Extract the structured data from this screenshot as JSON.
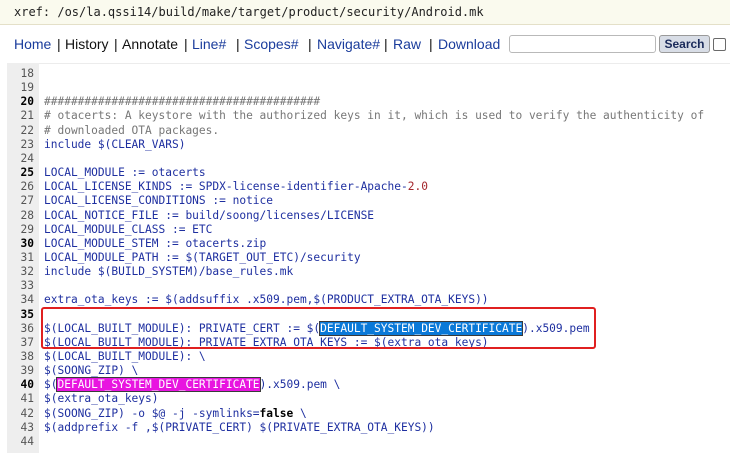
{
  "xref": {
    "text": "xref: /os/la.qssi14/build/make/target/product/security/Android.mk"
  },
  "nav": {
    "home": "Home",
    "history": "History",
    "annotate": "Annotate",
    "line": "Line#",
    "scopes": "Scopes#",
    "navigate": "Navigate#",
    "raw": "Raw",
    "download": "Download",
    "search_button": "Search",
    "search_value": ""
  },
  "code": {
    "lines": [
      {
        "n": "18",
        "t": ""
      },
      {
        "n": "19",
        "t": ""
      },
      {
        "n": "20",
        "t": "#########################################"
      },
      {
        "n": "21",
        "t": "# otacerts: A keystore with the authorized keys in it, which is used to verify the authenticity of"
      },
      {
        "n": "22",
        "t": "# downloaded OTA packages."
      },
      {
        "n": "23",
        "t": "include $(CLEAR_VARS)"
      },
      {
        "n": "24",
        "t": ""
      },
      {
        "n": "25",
        "t": "LOCAL_MODULE := otacerts"
      },
      {
        "n": "26",
        "t": "LOCAL_LICENSE_KINDS := SPDX-license-identifier-Apache-",
        "num": "2.0"
      },
      {
        "n": "27",
        "t": "LOCAL_LICENSE_CONDITIONS := notice"
      },
      {
        "n": "28",
        "t": "LOCAL_NOTICE_FILE := build/soong/licenses/LICENSE"
      },
      {
        "n": "29",
        "t": "LOCAL_MODULE_CLASS := ETC"
      },
      {
        "n": "30",
        "t": "LOCAL_MODULE_STEM := otacerts.zip"
      },
      {
        "n": "31",
        "t": "LOCAL_MODULE_PATH := $(TARGET_OUT_ETC)/security"
      },
      {
        "n": "32",
        "t": "include $(BUILD_SYSTEM)/base_rules.mk"
      },
      {
        "n": "33",
        "t": ""
      },
      {
        "n": "34",
        "t": "extra_ota_keys := $(addsuffix .x509.pem,$(PRODUCT_EXTRA_OTA_KEYS))"
      },
      {
        "n": "35",
        "t": ""
      },
      {
        "n": "36",
        "pre": "$(LOCAL_BUILT_MODULE): PRIVATE_CERT := $(",
        "hl": "DEFAULT_SYSTEM_DEV_CERTIFICATE",
        "post": ").x509.pem"
      },
      {
        "n": "37",
        "t": "$(LOCAL_BUILT_MODULE): PRIVATE_EXTRA_OTA_KEYS := $(extra_ota_keys)"
      },
      {
        "n": "38",
        "t": "$(LOCAL_BUILT_MODULE): \\"
      },
      {
        "n": "39",
        "t": "        $(SOONG_ZIP) \\"
      },
      {
        "n": "40",
        "pre": "        $(",
        "hl": "DEFAULT_SYSTEM_DEV_CERTIFICATE",
        "post": ").x509.pem \\"
      },
      {
        "n": "41",
        "t": "        $(extra_ota_keys)"
      },
      {
        "n": "42",
        "pre": "  $(SOONG_ZIP) -o $@ -j -symlinks=",
        "kw": "false",
        "post": " \\"
      },
      {
        "n": "43",
        "t": "        $(addprefix -f ,$(PRIVATE_CERT) $(PRIVATE_EXTRA_OTA_KEYS))"
      },
      {
        "n": "44",
        "t": ""
      }
    ]
  }
}
